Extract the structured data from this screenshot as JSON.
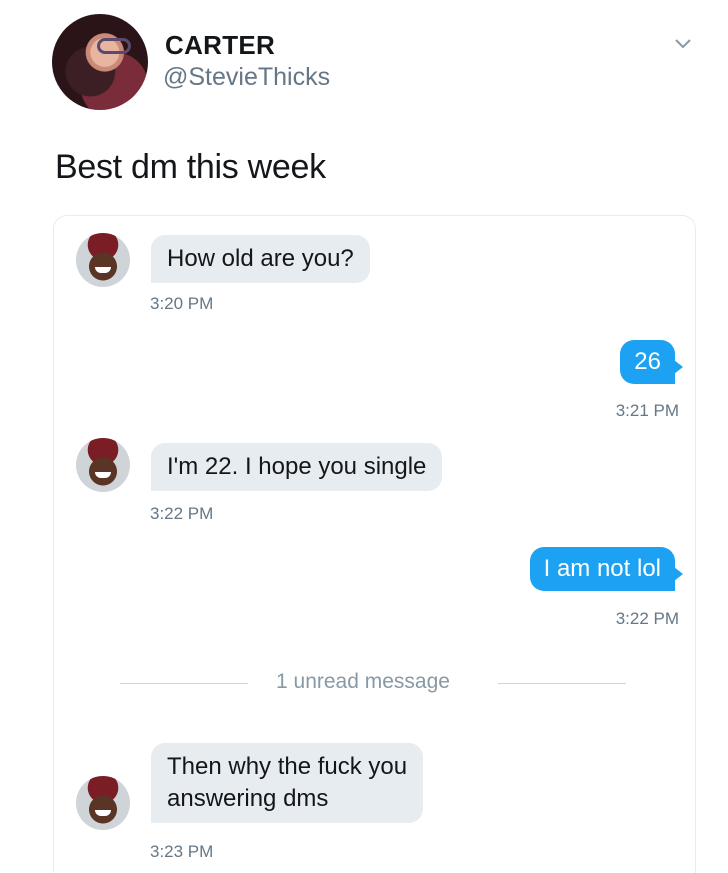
{
  "tweet": {
    "author_name": "CARTER",
    "author_handle": "@StevieThicks",
    "text": "Best dm this week"
  },
  "dm": {
    "messages": [
      {
        "direction": "incoming",
        "text": "How old are you?",
        "time": "3:20 PM"
      },
      {
        "direction": "outgoing",
        "text": "26",
        "time": "3:21 PM"
      },
      {
        "direction": "incoming",
        "text": "I'm 22. I hope you single",
        "time": "3:22 PM"
      },
      {
        "direction": "outgoing",
        "text": "I am not lol",
        "time": "3:22 PM"
      },
      {
        "direction": "incoming",
        "text_lines": [
          "Then why the fuck you",
          "answering dms"
        ],
        "time": "3:23 PM"
      }
    ],
    "unread_divider": "1 unread message"
  },
  "colors": {
    "outgoing_bubble": "#1da1f2",
    "incoming_bubble": "#e6ecf0",
    "secondary_text": "#657786"
  },
  "icons": [
    "chevron-down-icon"
  ]
}
